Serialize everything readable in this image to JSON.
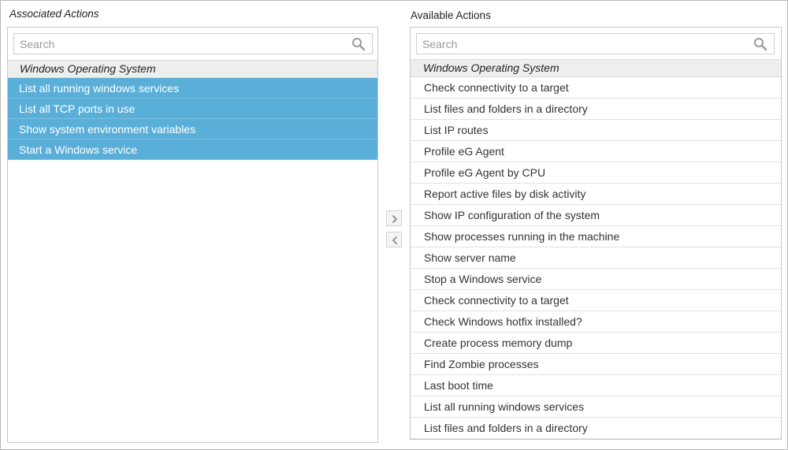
{
  "associated": {
    "title": "Associated Actions",
    "search_placeholder": "Search",
    "group": "Windows Operating System",
    "items": [
      "List all running windows services",
      "List all TCP ports in use",
      "Show system environment variables",
      "Start a Windows service"
    ]
  },
  "available": {
    "title": "Available Actions",
    "search_placeholder": "Search",
    "group": "Windows Operating System",
    "items": [
      "Check connectivity to a target",
      "List files and folders in a directory",
      "List IP routes",
      "Profile eG Agent",
      "Profile eG Agent by CPU",
      "Report active files by disk activity",
      "Show IP configuration of the system",
      "Show processes running in the machine",
      "Show server name",
      "Stop a Windows service",
      "Check connectivity to a target",
      "Check Windows hotfix installed?",
      "Create process memory dump",
      "Find Zombie processes",
      "Last boot time",
      "List all running windows services",
      "List files and folders in a directory"
    ]
  },
  "controls": {
    "move_right_icon": "chevron-right-icon",
    "move_left_icon": "chevron-left-icon"
  },
  "colors": {
    "selected_row": "#5aafd9",
    "group_header": "#eeeeee",
    "border": "#c9c9c9"
  }
}
